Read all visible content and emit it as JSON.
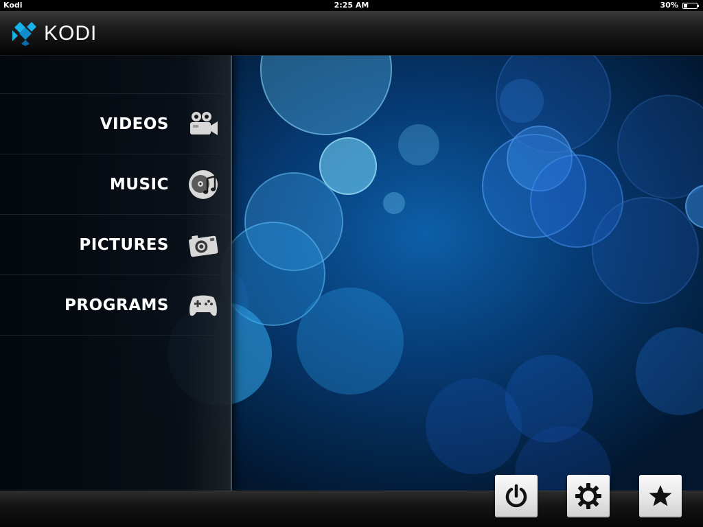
{
  "status_bar": {
    "app_name": "Kodi",
    "time": "2:25 AM",
    "battery_percent_text": "30%",
    "battery_level": 0.3
  },
  "header": {
    "logo_text": "KODI",
    "logo_colors": [
      "#17b2e7",
      "#0f8ccb",
      "#0b6aa8"
    ]
  },
  "menu": {
    "items": [
      {
        "label": "VIDEOS",
        "icon": "film-camera-icon"
      },
      {
        "label": "MUSIC",
        "icon": "music-disc-icon"
      },
      {
        "label": "PICTURES",
        "icon": "photo-camera-icon"
      },
      {
        "label": "PROGRAMS",
        "icon": "gamepad-icon"
      }
    ]
  },
  "controls": [
    {
      "name": "power-button",
      "icon": "power-icon"
    },
    {
      "name": "settings-button",
      "icon": "gear-icon"
    },
    {
      "name": "favourites-button",
      "icon": "star-icon"
    }
  ],
  "colors": {
    "background_blue": "#0d5fa8",
    "menu_text": "#ffffff",
    "icon_gray": "#d8d8d8"
  }
}
